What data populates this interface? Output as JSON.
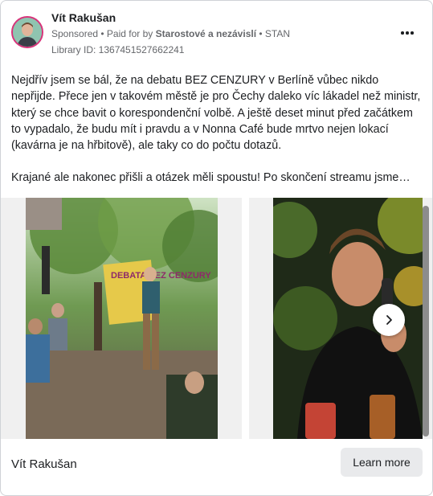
{
  "post": {
    "author": "Vít Rakušan",
    "sponsored_label": "Sponsored",
    "paid_prefix": "• Paid for by",
    "sponsor": "Starostové a nezávislí",
    "sponsor_suffix": "• STAN",
    "library_id": "Library ID: 1367451527662241",
    "paragraph_1": "Nejdřív jsem se bál, že na debatu BEZ CENZURY v Berlíně vůbec nikdo nepřijde. Přece jen v takovém městě je pro Čechy daleko víc lákadel než ministr, který se chce bavit o korespondenční volbě. A ještě deset minut před začátkem to vypadalo, že budu mít i pravdu a v Nonna Café bude mrtvo nejen lokací (kavárna je na hřbitově), ale taky co do počtu dotazů.",
    "paragraph_2": "Krajané ale nakonec přišli a otázek měli spoustu! Po skončení streamu jsme…"
  },
  "carousel": {
    "slides": [
      {
        "icon": "photo-speaker-garden-event"
      },
      {
        "icon": "photo-man-with-microphone"
      }
    ],
    "banner_text": "DEBATA BEZ CENZURY"
  },
  "footer": {
    "page_name": "Vít Rakušan",
    "cta_label": "Learn more"
  },
  "colors": {
    "avatar_ring": "#d8337a",
    "text_primary": "#1c1e21",
    "text_secondary": "#65676b",
    "button_bg": "#e9eaec"
  }
}
